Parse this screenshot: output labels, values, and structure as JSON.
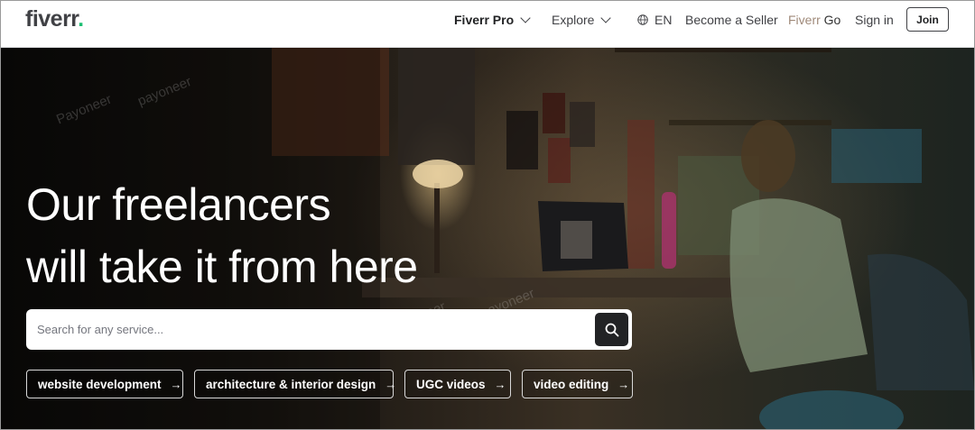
{
  "header": {
    "logo": "fiverr",
    "logo_dot": ".",
    "nav": {
      "fiverr_pro": "Fiverr Pro",
      "explore": "Explore",
      "language": "EN",
      "become_seller": "Become a Seller",
      "fiverr_go_prefix": "Fiverr",
      "fiverr_go_suffix": "Go",
      "sign_in": "Sign in",
      "join": "Join"
    }
  },
  "hero": {
    "title_line1": "Our freelancers",
    "title_line2": "will take it from here",
    "search": {
      "placeholder": "Search for any service...",
      "value": ""
    },
    "chips": [
      {
        "label": "website development",
        "arrow": "→"
      },
      {
        "label": "architecture & interior design",
        "arrow": "→"
      },
      {
        "label": "UGC videos",
        "arrow": "→"
      },
      {
        "label": "video editing",
        "arrow": "→"
      }
    ]
  },
  "colors": {
    "brand_green": "#1dbf73",
    "text_dark": "#404145",
    "button_dark": "#222325"
  },
  "icons": [
    "chevron-down-icon",
    "globe-icon",
    "search-icon",
    "arrow-right-icon"
  ]
}
